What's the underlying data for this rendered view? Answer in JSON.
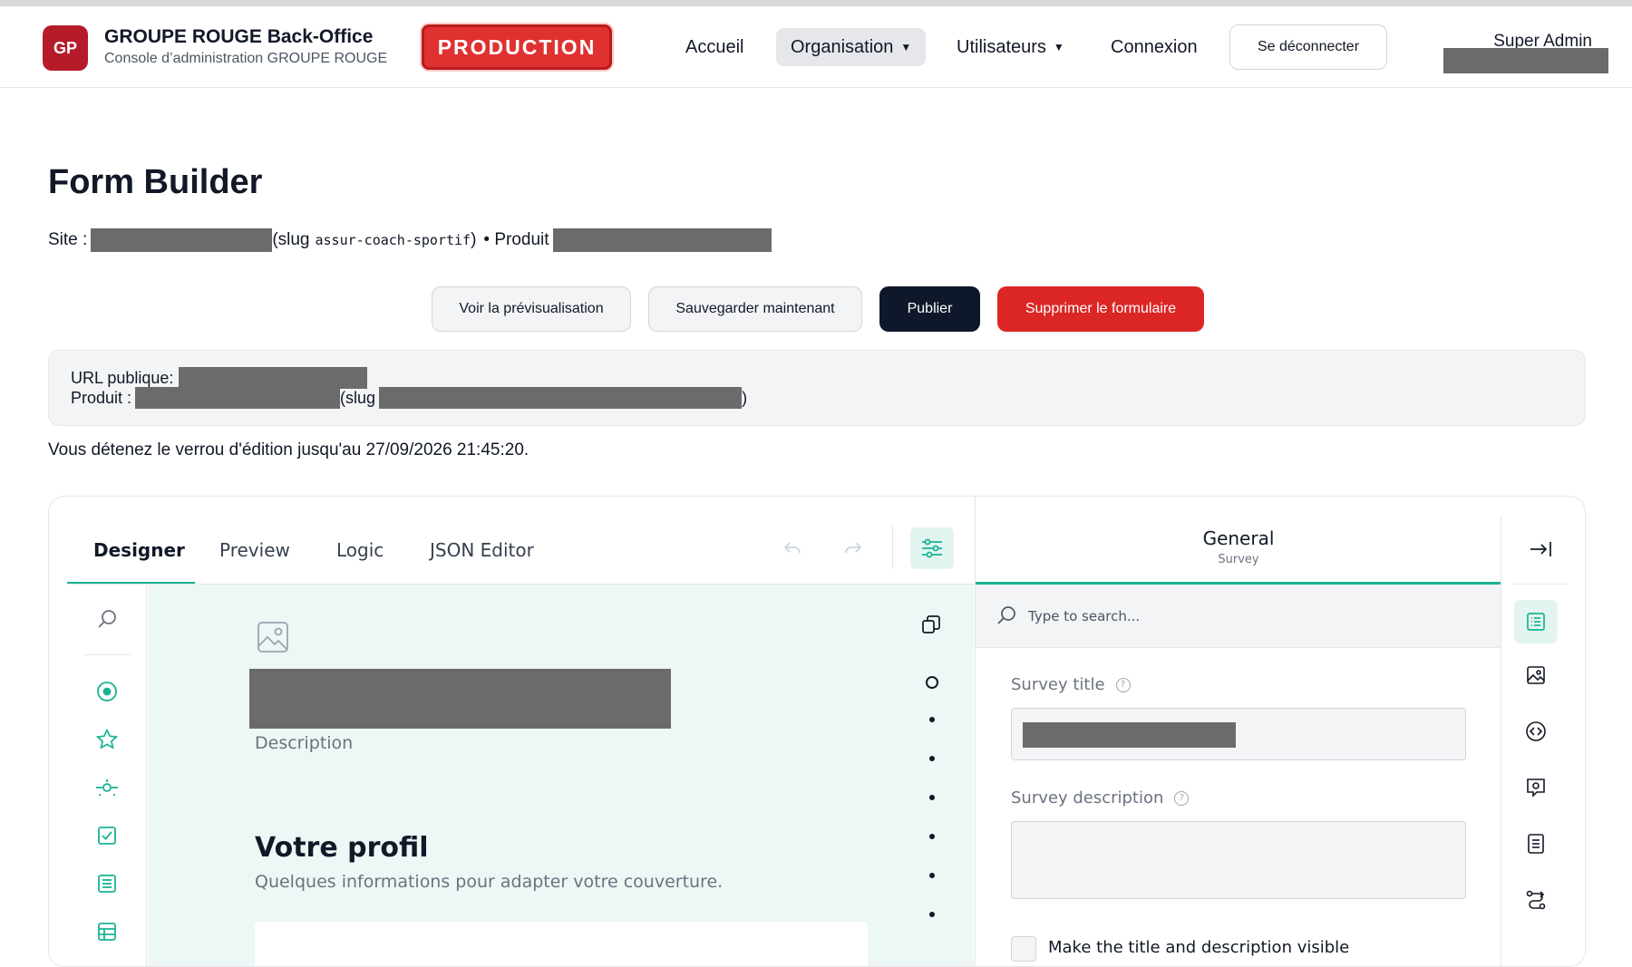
{
  "header": {
    "logo_initials": "GP",
    "brand_title": "GROUPE ROUGE Back-Office",
    "brand_subtitle": "Console d’administration GROUPE ROUGE",
    "env_badge": "PRODUCTION",
    "nav": {
      "home": "Accueil",
      "organisation": "Organisation",
      "users": "Utilisateurs",
      "connexion": "Connexion"
    },
    "logout_label": "Se déconnecter",
    "user_name": "Super Admin"
  },
  "page": {
    "title": "Form Builder",
    "site_label": "Site :",
    "slug_prefix": "(slug",
    "slug_value": "assur-coach-sportif",
    "slug_suffix": ")",
    "product_label": "• Produit",
    "actions": {
      "preview": "Voir la prévisualisation",
      "save": "Sauvegarder maintenant",
      "publish": "Publier",
      "delete": "Supprimer le formulaire"
    },
    "url_box": {
      "url_label": "URL publique:",
      "product_label": "Produit :",
      "slug_prefix": "(slug",
      "slug_suffix": ")"
    },
    "lock_message": "Vous détenez le verrou d'édition jusqu'au 27/09/2026 21:45:20."
  },
  "builder": {
    "tabs": {
      "designer": "Designer",
      "preview": "Preview",
      "logic": "Logic",
      "json": "JSON Editor"
    },
    "canvas": {
      "description_placeholder": "Description",
      "page_title": "Votre profil",
      "page_description": "Quelques informations pour adapter votre couverture."
    },
    "properties": {
      "header_title": "General",
      "header_subtitle": "Survey",
      "search_placeholder": "Type to search...",
      "survey_title_label": "Survey title",
      "survey_description_label": "Survey description",
      "visible_checkbox_label": "Make the title and description visible"
    },
    "icons": {
      "left_toolbar": [
        "search-icon",
        "radio-icon",
        "star-icon",
        "slider-icon",
        "checkbox-icon",
        "multiline-icon",
        "table-icon"
      ],
      "right_rail": [
        "collapse-panel-icon",
        "general-settings-icon",
        "logo-image-icon",
        "navigation-icon",
        "question-settings-icon",
        "pages-icon",
        "logic-icon"
      ]
    }
  },
  "colors": {
    "accent": "#19b394",
    "brand_red": "#b51c2a",
    "danger": "#dc2626",
    "dark_button": "#0f172a",
    "redaction": "#6b6b6b",
    "canvas_bg": "#edf7f5"
  }
}
